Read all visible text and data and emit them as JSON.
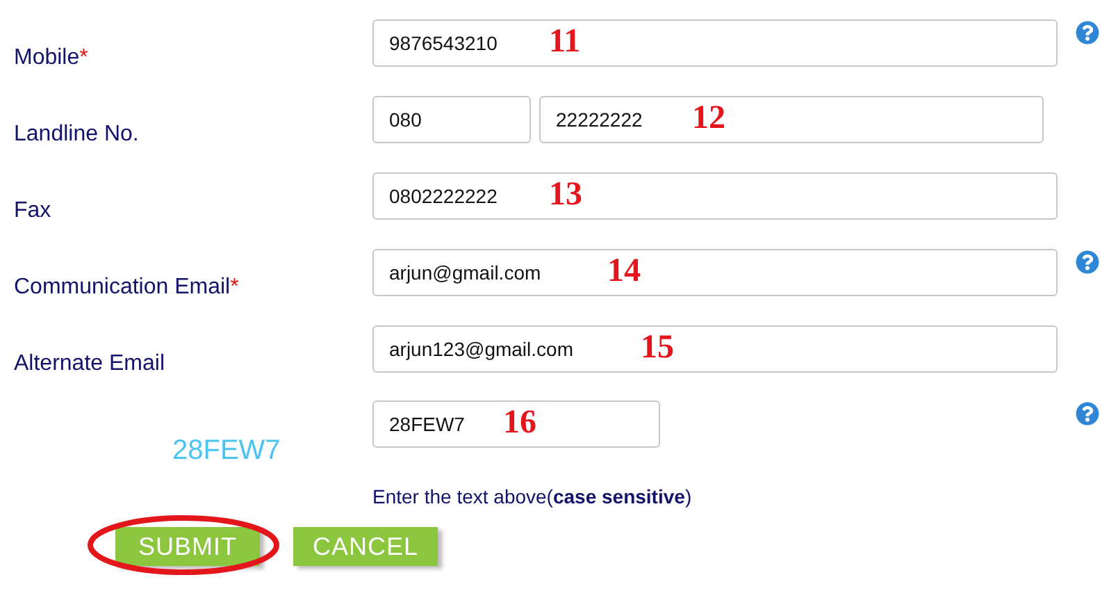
{
  "fields": [
    {
      "kind": "single",
      "label": "Mobile",
      "required_mark": "*",
      "values": [
        "9876543210"
      ],
      "annotation": "11",
      "help": true
    },
    {
      "kind": "split",
      "label": "Landline No.",
      "values": [
        "080",
        "22222222"
      ],
      "annotation": "12",
      "help": false
    },
    {
      "kind": "single",
      "label": "Fax",
      "values": [
        "0802222222"
      ],
      "annotation": "13",
      "help": false
    },
    {
      "kind": "single",
      "label": "Communication Email",
      "required_mark": "*",
      "values": [
        "arjun@gmail.com"
      ],
      "annotation": "14",
      "help": true
    },
    {
      "kind": "single",
      "label": "Alternate Email",
      "values": [
        "arjun123@gmail.com"
      ],
      "annotation": "15",
      "help": false
    }
  ],
  "captcha": {
    "code": "28FEW7",
    "value": "28FEW7",
    "annotation": "16",
    "help": true,
    "hint": "Enter the text above(**case sensitive**)"
  },
  "buttons": [
    {
      "label": "SUBMIT",
      "circled": true
    },
    {
      "label": "CANCEL",
      "circled": false
    }
  ]
}
